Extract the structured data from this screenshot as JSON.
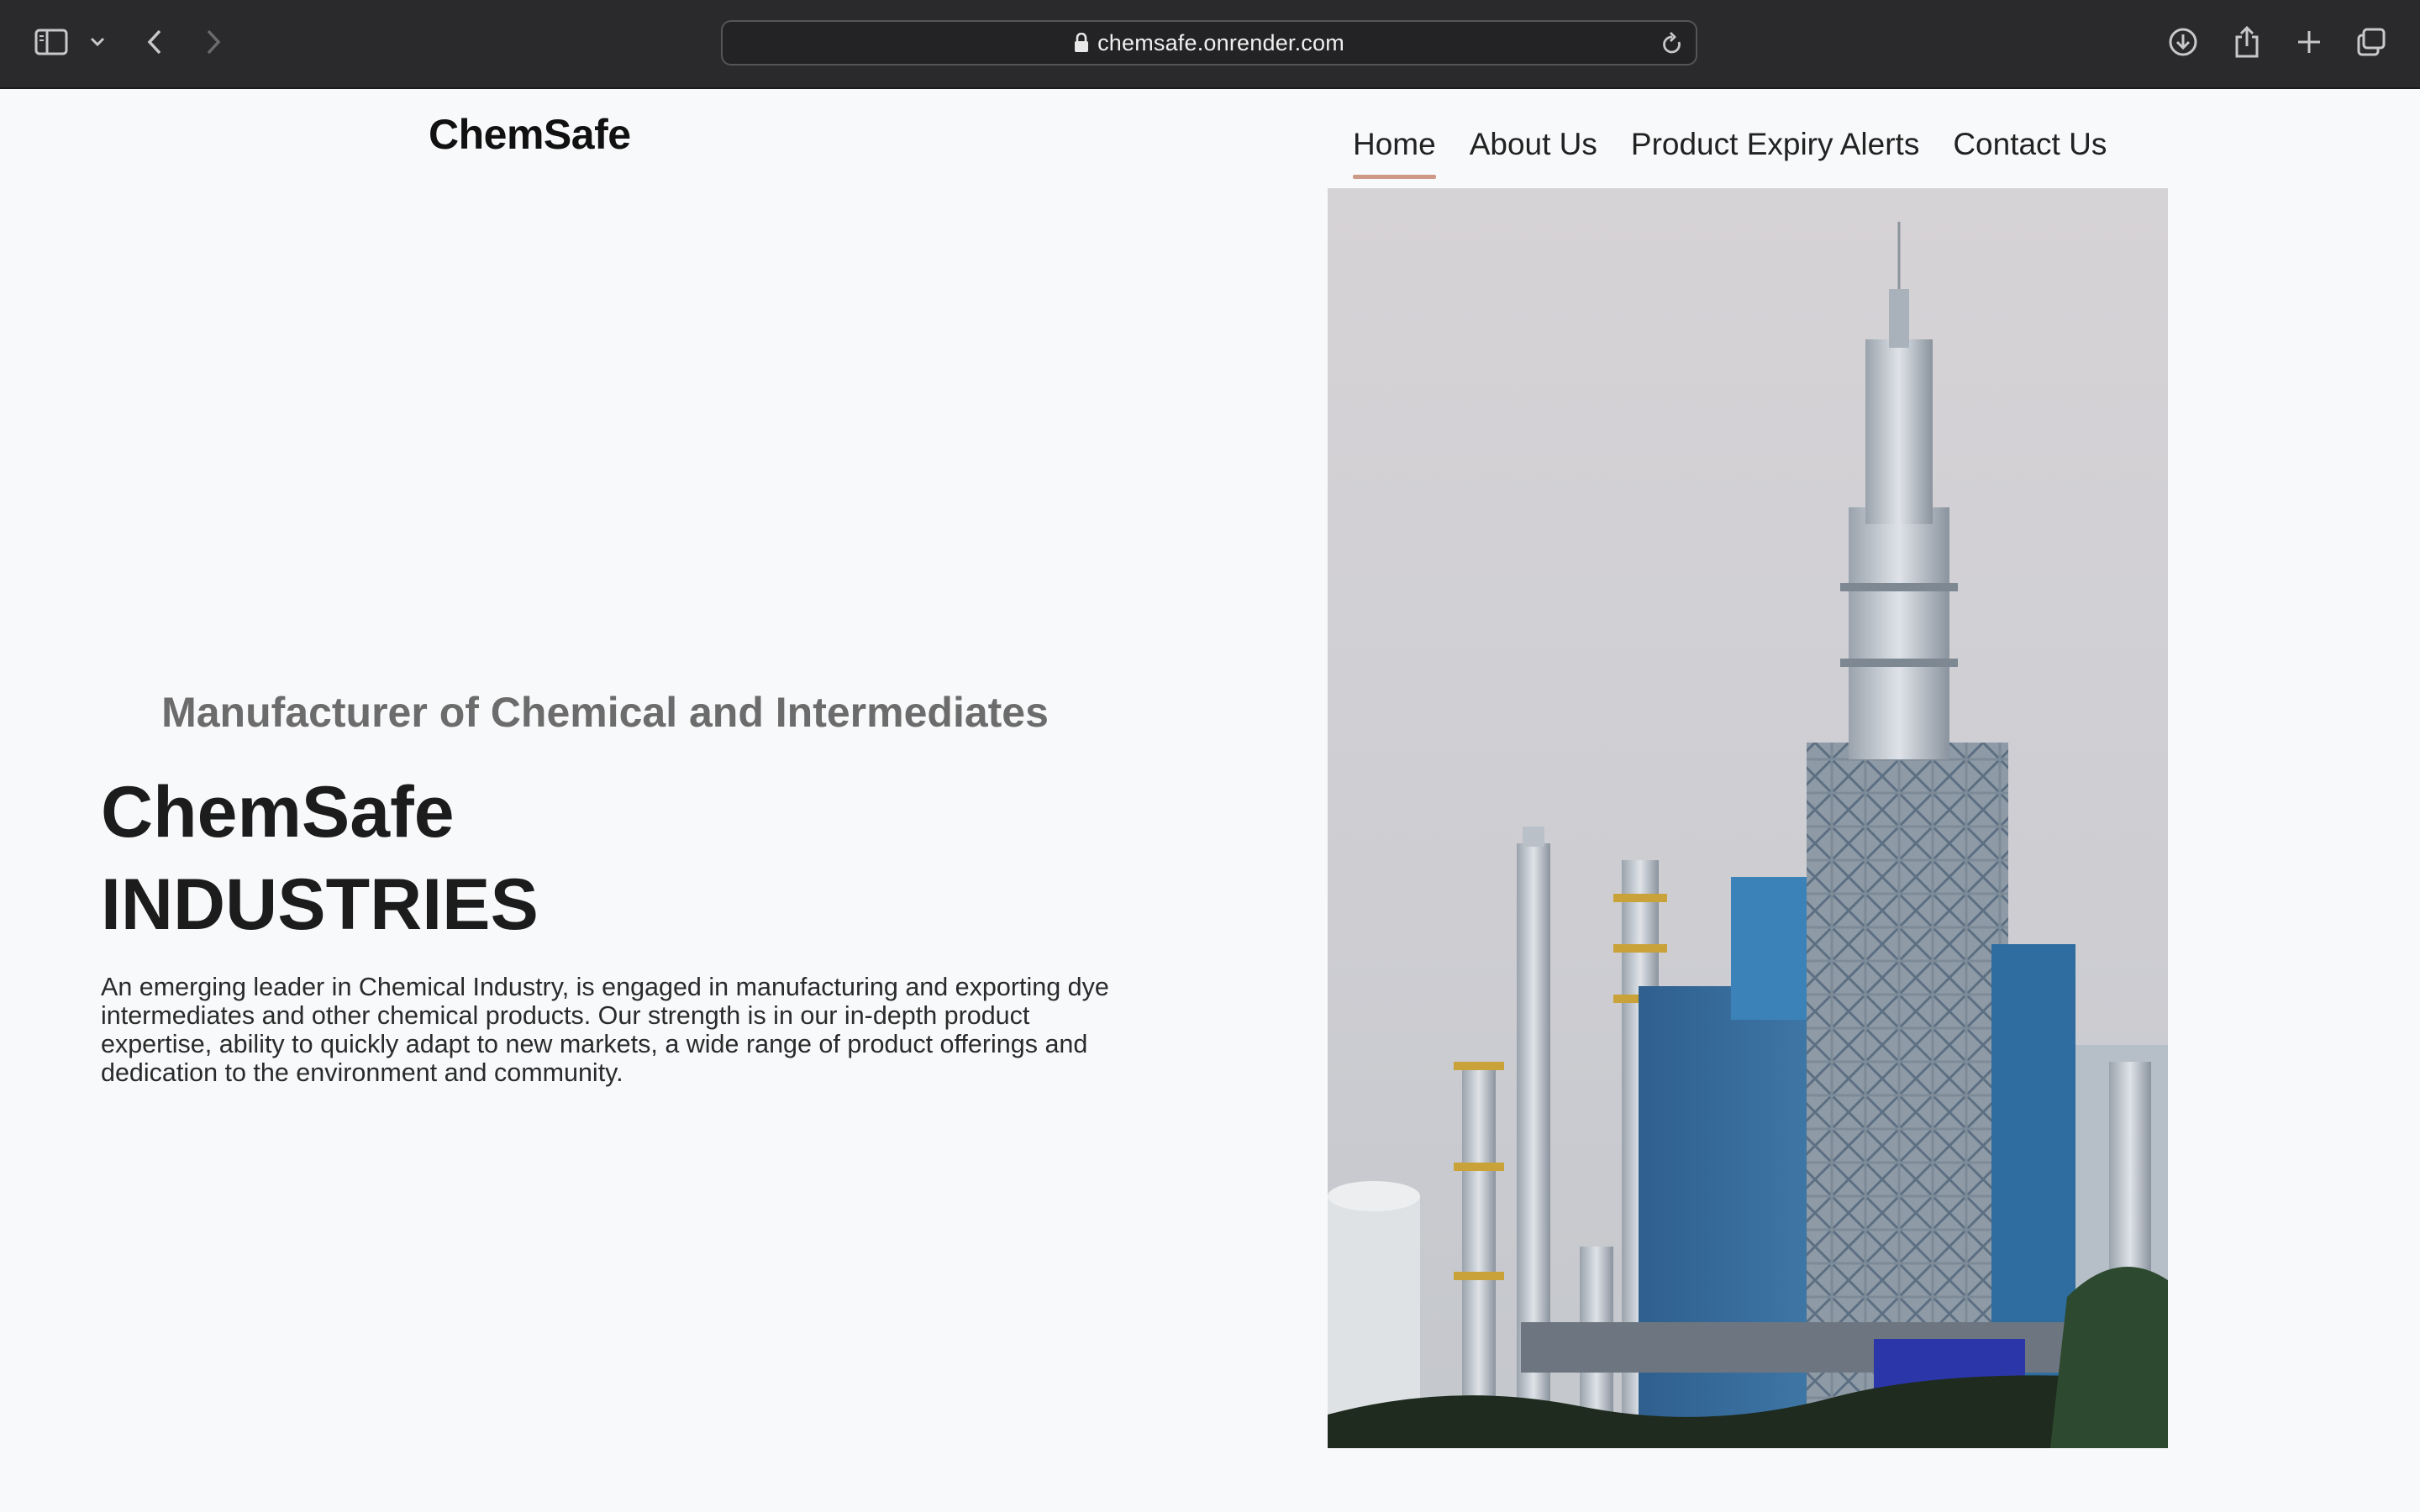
{
  "browser": {
    "url": "chemsafe.onrender.com",
    "icons": [
      "sidebar-icon",
      "chevron-down-icon",
      "back-icon",
      "forward-icon",
      "lock-icon",
      "reload-icon",
      "download-icon",
      "share-icon",
      "new-tab-icon",
      "tab-overview-icon"
    ]
  },
  "site": {
    "logo": "ChemSafe",
    "nav": [
      "Home",
      "About Us",
      "Product Expiry Alerts",
      "Contact Us"
    ],
    "active_nav": "Home",
    "accent_color": "#cd9a86"
  },
  "hero": {
    "tagline": "Manufacturer of Chemical and Intermediates",
    "title_line1": "ChemSafe",
    "title_line2": "INDUSTRIES",
    "description": "An emerging leader in Chemical Industry, is engaged in manufacturing and exporting dye intermediates and other chemical products. Our strength is in our in-depth product expertise, ability to quickly adapt to new markets, a wide range of product offerings and dedication to the environment and community."
  }
}
